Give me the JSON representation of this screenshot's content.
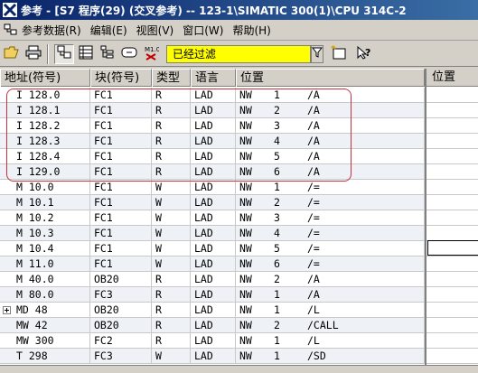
{
  "window": {
    "title": "参考 - [S7 程序(29) (交叉参考) -- 123-1\\SIMATIC 300(1)\\CPU 314C-2"
  },
  "menu": [
    {
      "label": "参考数据(R)",
      "icon": "cross-ref-icon"
    },
    {
      "label": "编辑(E)"
    },
    {
      "label": "视图(V)"
    },
    {
      "label": "窗口(W)"
    },
    {
      "label": "帮助(H)"
    }
  ],
  "toolbar": {
    "filter_value": "已经过滤",
    "buttons": [
      "open-icon",
      "print-icon",
      "cross-ref-view-icon",
      "assignment-icon",
      "program-structure-icon",
      "unused-symbols-icon",
      "no-symbol-icon",
      "filter-icon",
      "new-window-icon",
      "help-icon"
    ]
  },
  "table": {
    "columns": [
      "地址(符号)",
      "块(符号)",
      "类型",
      "语言",
      "位置"
    ],
    "rows": [
      {
        "address": "I 128.0",
        "block": "FC1",
        "type": "R",
        "lang": "LAD",
        "net": "NW",
        "num": "1",
        "instr": "/A"
      },
      {
        "address": "I 128.1",
        "block": "FC1",
        "type": "R",
        "lang": "LAD",
        "net": "NW",
        "num": "2",
        "instr": "/A"
      },
      {
        "address": "I 128.2",
        "block": "FC1",
        "type": "R",
        "lang": "LAD",
        "net": "NW",
        "num": "3",
        "instr": "/A"
      },
      {
        "address": "I 128.3",
        "block": "FC1",
        "type": "R",
        "lang": "LAD",
        "net": "NW",
        "num": "4",
        "instr": "/A"
      },
      {
        "address": "I 128.4",
        "block": "FC1",
        "type": "R",
        "lang": "LAD",
        "net": "NW",
        "num": "5",
        "instr": "/A"
      },
      {
        "address": "I 129.0",
        "block": "FC1",
        "type": "R",
        "lang": "LAD",
        "net": "NW",
        "num": "6",
        "instr": "/A"
      },
      {
        "address": "M 10.0",
        "block": "FC1",
        "type": "W",
        "lang": "LAD",
        "net": "NW",
        "num": "1",
        "instr": "/="
      },
      {
        "address": "M 10.1",
        "block": "FC1",
        "type": "W",
        "lang": "LAD",
        "net": "NW",
        "num": "2",
        "instr": "/="
      },
      {
        "address": "M 10.2",
        "block": "FC1",
        "type": "W",
        "lang": "LAD",
        "net": "NW",
        "num": "3",
        "instr": "/="
      },
      {
        "address": "M 10.3",
        "block": "FC1",
        "type": "W",
        "lang": "LAD",
        "net": "NW",
        "num": "4",
        "instr": "/="
      },
      {
        "address": "M 10.4",
        "block": "FC1",
        "type": "W",
        "lang": "LAD",
        "net": "NW",
        "num": "5",
        "instr": "/="
      },
      {
        "address": "M 11.0",
        "block": "FC1",
        "type": "W",
        "lang": "LAD",
        "net": "NW",
        "num": "6",
        "instr": "/="
      },
      {
        "address": "M 40.0",
        "block": "OB20",
        "type": "R",
        "lang": "LAD",
        "net": "NW",
        "num": "2",
        "instr": "/A"
      },
      {
        "address": "M 80.0",
        "block": "FC3",
        "type": "R",
        "lang": "LAD",
        "net": "NW",
        "num": "1",
        "instr": "/A"
      },
      {
        "address": "MD 48",
        "block": "OB20",
        "type": "R",
        "lang": "LAD",
        "net": "NW",
        "num": "1",
        "instr": "/L",
        "expandable": true
      },
      {
        "address": "MW 42",
        "block": "OB20",
        "type": "R",
        "lang": "LAD",
        "net": "NW",
        "num": "2",
        "instr": "/CALL"
      },
      {
        "address": "MW 300",
        "block": "FC2",
        "type": "R",
        "lang": "LAD",
        "net": "NW",
        "num": "1",
        "instr": "/L"
      },
      {
        "address": "T 298",
        "block": "FC3",
        "type": "W",
        "lang": "LAD",
        "net": "NW",
        "num": "1",
        "instr": "/SD"
      }
    ]
  },
  "right_pane": {
    "header": "位置"
  },
  "colors": {
    "highlight": "#c83040",
    "filter_bg": "#ffff00"
  }
}
